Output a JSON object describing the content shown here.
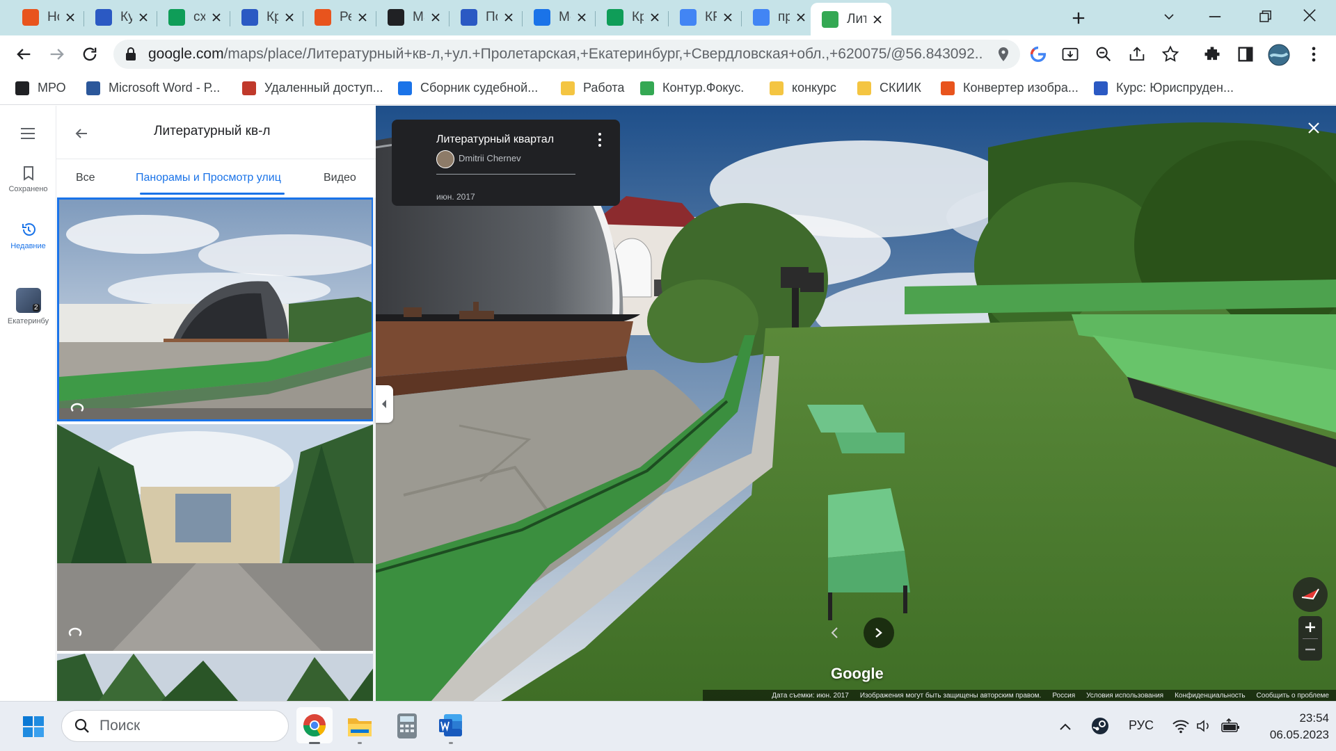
{
  "browser": {
    "tabs": [
      {
        "label": "Нов",
        "color": "#e8541d",
        "icon": "kinopoisk-icon"
      },
      {
        "label": "Кур",
        "color": "#2b59c3",
        "icon": "university-icon"
      },
      {
        "label": "схе",
        "color": "#0f9d58",
        "icon": "google-drive-icon"
      },
      {
        "label": "Кри",
        "color": "#2b59c3",
        "icon": "university-icon"
      },
      {
        "label": "Рек",
        "color": "#e8541d",
        "icon": "office-icon"
      },
      {
        "label": "Ма",
        "color": "#202124",
        "icon": "antiplagiat-icon"
      },
      {
        "label": "По",
        "color": "#2b59c3",
        "icon": "university-icon"
      },
      {
        "label": "Ме",
        "color": "#1a73e8",
        "icon": "chat-icon"
      },
      {
        "label": "Кри",
        "color": "#0f9d58",
        "icon": "google-drive-icon"
      },
      {
        "label": "КР",
        "color": "#4285f4",
        "icon": "google-docs-icon"
      },
      {
        "label": "пре",
        "color": "#4285f4",
        "icon": "google-icon"
      },
      {
        "label": "Лит",
        "color": "#34a853",
        "icon": "google-maps-icon"
      }
    ],
    "url_host": "google.com",
    "url_rest": "/maps/place/Литературный+кв-л,+ул.+Пролетарская,+Екатеринбург,+Свердловская+обл.,+620075/@56.843092...",
    "bookmarks": [
      {
        "label": "МРО",
        "color": "#202124"
      },
      {
        "label": "Microsoft Word - Р...",
        "color": "#2b579a"
      },
      {
        "label": "Удаленный доступ...",
        "color": "#c0392b"
      },
      {
        "label": "Сборник судебной...",
        "color": "#1a73e8"
      },
      {
        "label": "Работа",
        "color": "#f4c542"
      },
      {
        "label": "Контур.Фокус.",
        "color": "#34a853"
      },
      {
        "label": "конкурс",
        "color": "#f4c542"
      },
      {
        "label": "СКИИК",
        "color": "#f4c542"
      },
      {
        "label": "Конвертер изобра...",
        "color": "#e8541d"
      },
      {
        "label": "Курс: Юриспруден...",
        "color": "#2b59c3"
      }
    ]
  },
  "maps": {
    "rail": {
      "saved": "Сохранено",
      "recent": "Недавние",
      "city": "Екатеринбу"
    },
    "panel": {
      "title": "Литературный кв-л",
      "tabs": [
        "Все",
        "Панорамы и Просмотр улиц",
        "Видео"
      ]
    },
    "streetview": {
      "card_title": "Литературный квартал",
      "author": "Dmitrii Chernev",
      "date": "июн. 2017",
      "logo": "Google",
      "footer": [
        "Дата съемки: июн. 2017",
        "Изображения могут быть защищены авторским правом.",
        "Россия",
        "Условия использования",
        "Конфиденциальность",
        "Сообщить о проблеме"
      ]
    }
  },
  "taskbar": {
    "search_placeholder": "Поиск",
    "language": "РУС",
    "time": "23:54",
    "date": "06.05.2023"
  },
  "colors": {
    "tabstrip": "#c6e3e8",
    "accent": "#1a73e8"
  }
}
